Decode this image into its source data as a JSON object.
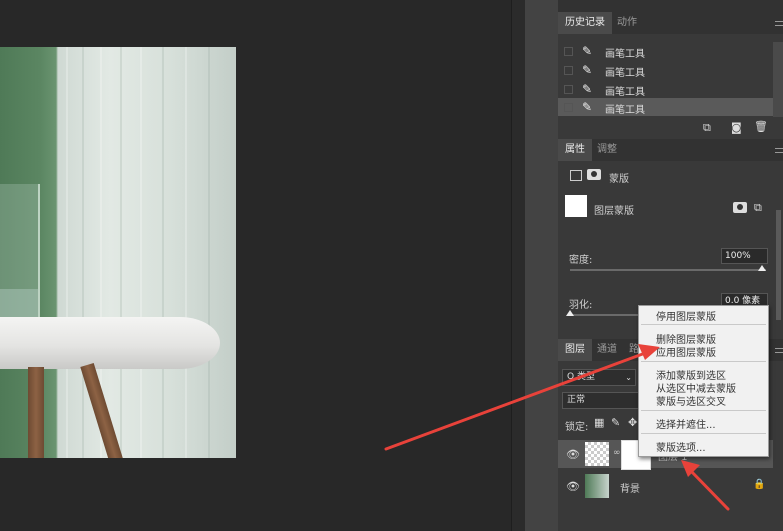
{
  "history_panel": {
    "tabs": [
      "历史记录",
      "动作"
    ],
    "items": [
      "画笔工具",
      "画笔工具",
      "画笔工具",
      "画笔工具"
    ]
  },
  "properties_panel": {
    "tabs": [
      "属性",
      "调整"
    ],
    "mask_type": "蒙版",
    "layer_mask_label": "图层蒙版",
    "density_label": "密度:",
    "density_value": "100%",
    "density_level": 1.0,
    "feather_label": "羽化:",
    "feather_value": "0.0 像素",
    "feather_level": 0.0
  },
  "layers_panel": {
    "tabs": [
      "图层",
      "通道",
      "路"
    ],
    "filter_kind": "Q 类型",
    "blend_mode": "正常",
    "lock_label": "锁定:",
    "layers": [
      {
        "name": "图层 1"
      },
      {
        "name": "背景"
      }
    ]
  },
  "context_menu": {
    "groups": [
      [
        "停用图层蒙版"
      ],
      [
        "删除图层蒙版",
        "应用图层蒙版"
      ],
      [
        "添加蒙版到选区",
        "从选区中减去蒙版",
        "蒙版与选区交叉"
      ],
      [
        "选择并遮住..."
      ],
      [
        "蒙版选项..."
      ]
    ]
  },
  "colors": {
    "arrow": "#e8423a",
    "panel_bg": "#393939",
    "canvas_bg": "#282828"
  }
}
